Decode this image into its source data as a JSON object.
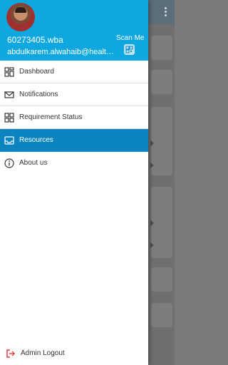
{
  "header": {
    "user_id": "60273405.wba",
    "email": "abdulkarem.alwahaib@health.n...",
    "scan_label": "Scan Me",
    "background_color": "#0ea7e0"
  },
  "menu": {
    "items": [
      {
        "label": "Dashboard",
        "icon": "dashboard-icon",
        "active": false
      },
      {
        "label": "Notifications",
        "icon": "mail-icon",
        "active": false
      },
      {
        "label": "Requirement Status",
        "icon": "grid-icon",
        "active": false
      },
      {
        "label": "Resources",
        "icon": "inbox-icon",
        "active": true
      },
      {
        "label": "About us",
        "icon": "info-icon",
        "active": false
      }
    ],
    "active_color": "#0b84c0"
  },
  "logout": {
    "label": "Admin Logout",
    "icon": "logout-icon",
    "color": "#e53935"
  }
}
